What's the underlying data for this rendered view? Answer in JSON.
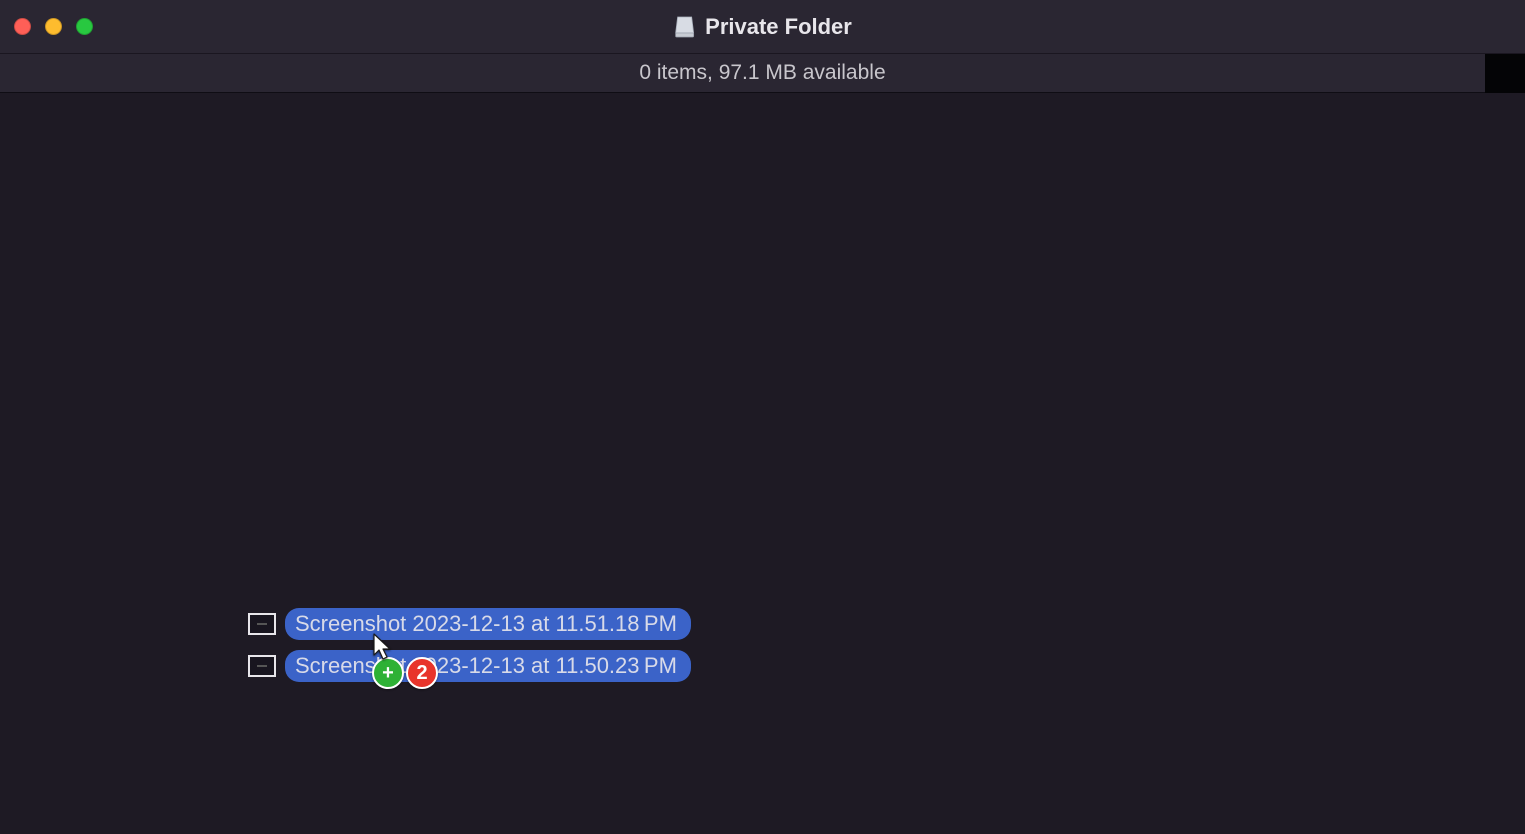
{
  "window": {
    "title": "Private Folder",
    "status": "0 items, 97.1 MB available"
  },
  "drag": {
    "files": [
      {
        "name": "Screenshot 2023-12-13 at 11.51.18 PM"
      },
      {
        "name": "Screenshot 2023-12-13 at 11.50.23 PM"
      }
    ],
    "count": "2",
    "action": "+"
  },
  "icons": {
    "volume": "disk-icon"
  }
}
